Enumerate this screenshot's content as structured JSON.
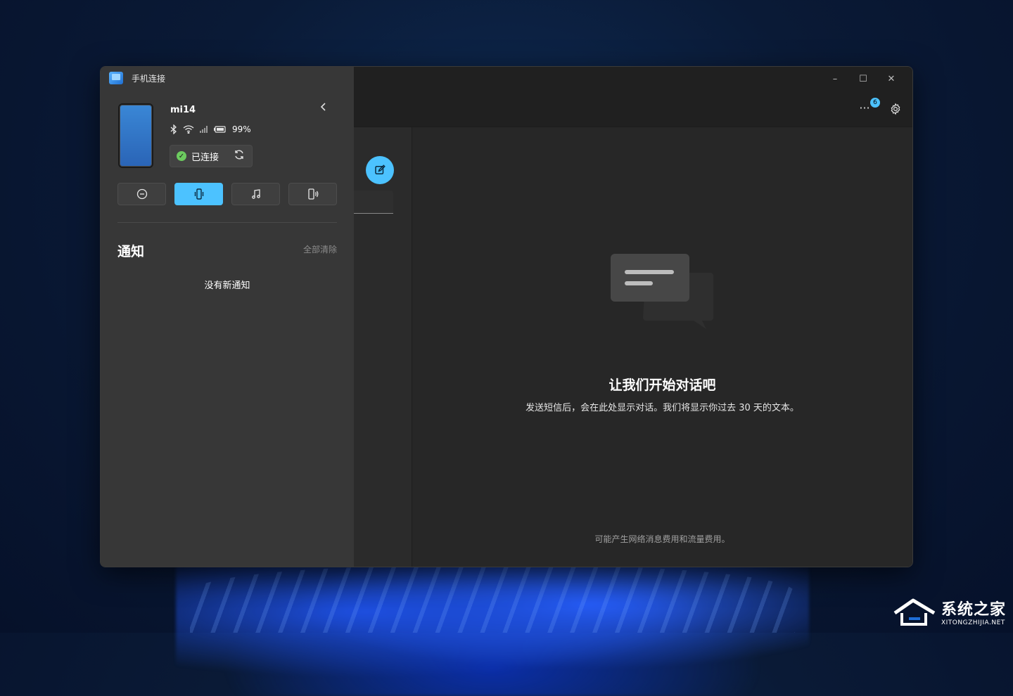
{
  "app": {
    "title": "手机连接"
  },
  "window_controls": {
    "minimize": "–",
    "maximize": "☐",
    "close": "✕"
  },
  "header": {
    "badge_count": "6",
    "more_label": "···"
  },
  "device": {
    "name": "mi14",
    "battery": "99%",
    "connection_status": "已连接",
    "status_icons": [
      "bluetooth-icon",
      "wifi-icon",
      "signal-icon",
      "battery-icon"
    ]
  },
  "quick_actions": [
    {
      "name": "do-not-disturb",
      "active": false
    },
    {
      "name": "vibrate",
      "active": true
    },
    {
      "name": "music",
      "active": false
    },
    {
      "name": "phone-audio",
      "active": false
    }
  ],
  "notifications": {
    "title": "通知",
    "clear_all": "全部清除",
    "empty_text": "没有新通知"
  },
  "messages": {
    "empty_title": "让我们开始对话吧",
    "empty_subtitle": "发送短信后，会在此处显示对话。我们将显示你过去 30 天的文本。",
    "footer_note": "可能产生网络消息费用和流量费用。"
  },
  "watermark": {
    "cn": "系统之家",
    "en": "XITONGZHIJIA.NET"
  },
  "colors": {
    "accent": "#4cc2ff",
    "success": "#6ccb5f",
    "panel": "#373737",
    "window": "#202020"
  }
}
